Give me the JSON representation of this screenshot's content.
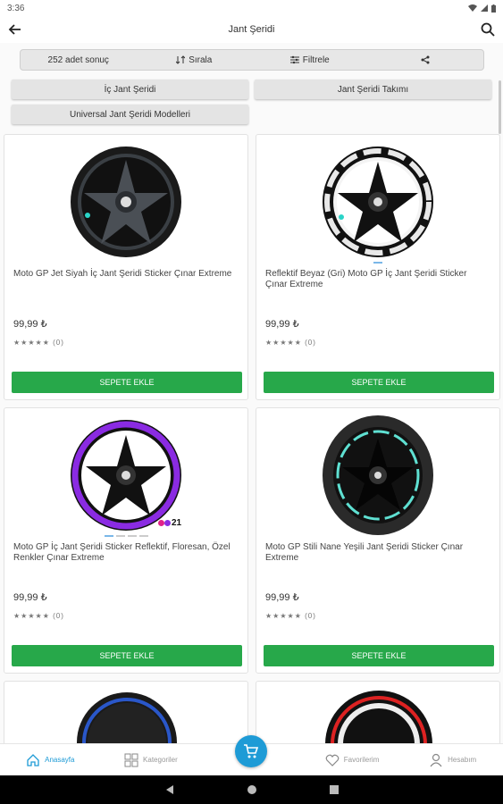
{
  "status_bar": {
    "time": "3:36"
  },
  "header": {
    "title": "Jant Şeridi"
  },
  "toolbar": {
    "result_count": "252 adet sonuç",
    "sort_label": "Sırala",
    "filter_label": "Filtrele"
  },
  "chips": [
    {
      "label": "İç Jant Şeridi"
    },
    {
      "label": "Jant Şeridi Takımı"
    },
    {
      "label": "Universal Jant Şeridi Modelleri"
    }
  ],
  "products": [
    {
      "name": "Moto GP Jet Siyah İç Jant Şeridi Sticker Çınar Extreme",
      "price": "99,99 ₺",
      "rating": "★★★★★ (0)",
      "button": "SEPETE EKLE"
    },
    {
      "name": "Reflektif Beyaz (Gri) Moto GP İç Jant Şeridi Sticker Çınar Extreme",
      "price": "99,99 ₺",
      "rating": "★★★★★ (0)",
      "button": "SEPETE EKLE"
    },
    {
      "name": "Moto GP İç Jant Şeridi Sticker Reflektif, Floresan, Özel Renkler Çınar Extreme",
      "price": "99,99 ₺",
      "rating": "★★★★★ (0)",
      "button": "SEPETE EKLE",
      "badge": "21"
    },
    {
      "name": "Moto GP Stili Nane Yeşili Jant Şeridi Sticker Çınar Extreme",
      "price": "99,99 ₺",
      "rating": "★★★★★ (0)",
      "button": "SEPETE EKLE"
    }
  ],
  "bottom_nav": [
    {
      "label": "Anasayfa",
      "icon": "home-icon"
    },
    {
      "label": "Kategoriler",
      "icon": "grid-icon"
    },
    {
      "label": "Favorilerim",
      "icon": "heart-icon"
    },
    {
      "label": "Hesabım",
      "icon": "user-icon"
    }
  ],
  "colors": {
    "accent": "#1e9bd6",
    "cart_button": "#27a84a"
  }
}
